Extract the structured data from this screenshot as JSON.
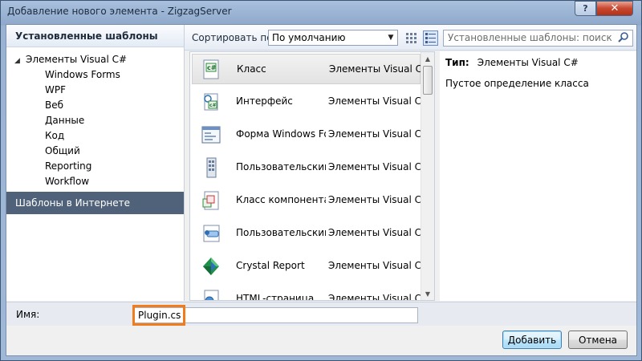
{
  "window": {
    "title": "Добавление нового элемента - ZigzagServer",
    "help_label": "?",
    "close_label": "✕"
  },
  "left_pane": {
    "header": "Установленные шаблоны",
    "root": "Элементы Visual C#",
    "children": [
      "Windows Forms",
      "WPF",
      "Веб",
      "Данные",
      "Код",
      "Общий",
      "Reporting",
      "Workflow"
    ],
    "online": "Шаблоны в Интернете"
  },
  "toolbar": {
    "sort_label": "Сортировать по:",
    "sort_value": "По умолчанию",
    "search_placeholder": "Установленные шаблоны: поиск"
  },
  "templates": [
    {
      "name": "Класс",
      "type": "Элементы Visual C#",
      "icon": "class-icon",
      "selected": true
    },
    {
      "name": "Интерфейс",
      "type": "Элементы Visual C#",
      "icon": "interface-icon",
      "selected": false
    },
    {
      "name": "Форма Windows Fo...",
      "type": "Элементы Visual C#",
      "icon": "windows-form-icon",
      "selected": false
    },
    {
      "name": "Пользовательский...",
      "type": "Элементы Visual C#",
      "icon": "user-control-icon",
      "selected": false
    },
    {
      "name": "Класс компонента",
      "type": "Элементы Visual C#",
      "icon": "component-class-icon",
      "selected": false
    },
    {
      "name": "Пользовательский...",
      "type": "Элементы Visual C#",
      "icon": "custom-control-icon",
      "selected": false
    },
    {
      "name": "Crystal Report",
      "type": "Элементы Visual C#",
      "icon": "crystal-report-icon",
      "selected": false
    },
    {
      "name": "HTML-страница",
      "type": "Элементы Visual C#",
      "icon": "html-page-icon",
      "selected": false
    }
  ],
  "details": {
    "type_label": "Тип:",
    "type_value": "Элементы Visual C#",
    "description": "Пустое определение класса"
  },
  "name_field": {
    "label": "Имя:",
    "value": "Plugin.cs"
  },
  "buttons": {
    "add": "Добавить",
    "cancel": "Отмена"
  },
  "colors": {
    "highlight": "#f27b1c",
    "online_bar": "#50617a",
    "title_close": "#c8472f"
  }
}
